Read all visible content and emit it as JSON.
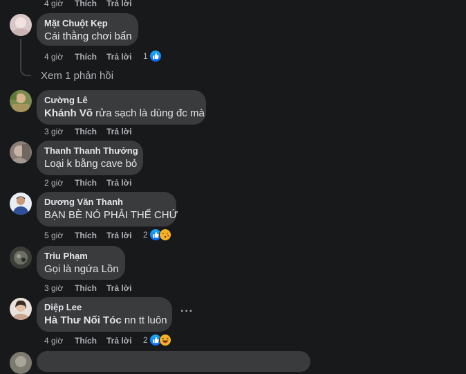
{
  "colors": {
    "background": "#18191a",
    "bubble": "#3a3b3c",
    "primary_text": "#e4e6eb",
    "secondary_text": "#b0b3b8",
    "like_blue": "#0866ff"
  },
  "top_actions": {
    "time": "4 giờ",
    "like": "Thích",
    "reply": "Trả lời"
  },
  "view_replies": "Xem 1 phản hồi",
  "comments": [
    {
      "name": "Mặt Chuột Kẹp",
      "tag": "",
      "text": "Cái thằng chơi bẩn",
      "time": "4 giờ",
      "like": "Thích",
      "reply": "Trả lời",
      "reaction_count": "1",
      "reactions": [
        "like-icon"
      ]
    },
    {
      "name": "Cường Lê",
      "tag": "Khánh Võ",
      "text": " rửa sạch là dùng đc mà",
      "time": "3 giờ",
      "like": "Thích",
      "reply": "Trả lời",
      "reaction_count": "",
      "reactions": []
    },
    {
      "name": "Thanh Thanh Thưởng",
      "tag": "",
      "text": "Loại k bằng cave bỏ",
      "time": "2 giờ",
      "like": "Thích",
      "reply": "Trả lời",
      "reaction_count": "",
      "reactions": []
    },
    {
      "name": "Dương Văn Thanh",
      "tag": "",
      "text": "BẠN BÈ NÓ PHẢI THẾ CHỨ",
      "time": "5 giờ",
      "like": "Thích",
      "reply": "Trả lời",
      "reaction_count": "2",
      "reactions": [
        "like-icon",
        "kiss-emoji-icon"
      ]
    },
    {
      "name": "Triu Phạm",
      "tag": "",
      "text": "Gọi là ngứa Lồn",
      "time": "3 giờ",
      "like": "Thích",
      "reply": "Trả lời",
      "reaction_count": "",
      "reactions": []
    },
    {
      "name": "Diệp Lee",
      "tag": "Hà Thư Nối Tóc",
      "text": " nn tt luôn",
      "time": "4 giờ",
      "like": "Thích",
      "reply": "Trả lời",
      "reaction_count": "2",
      "reactions": [
        "like-icon",
        "laugh-emoji-icon"
      ]
    }
  ]
}
